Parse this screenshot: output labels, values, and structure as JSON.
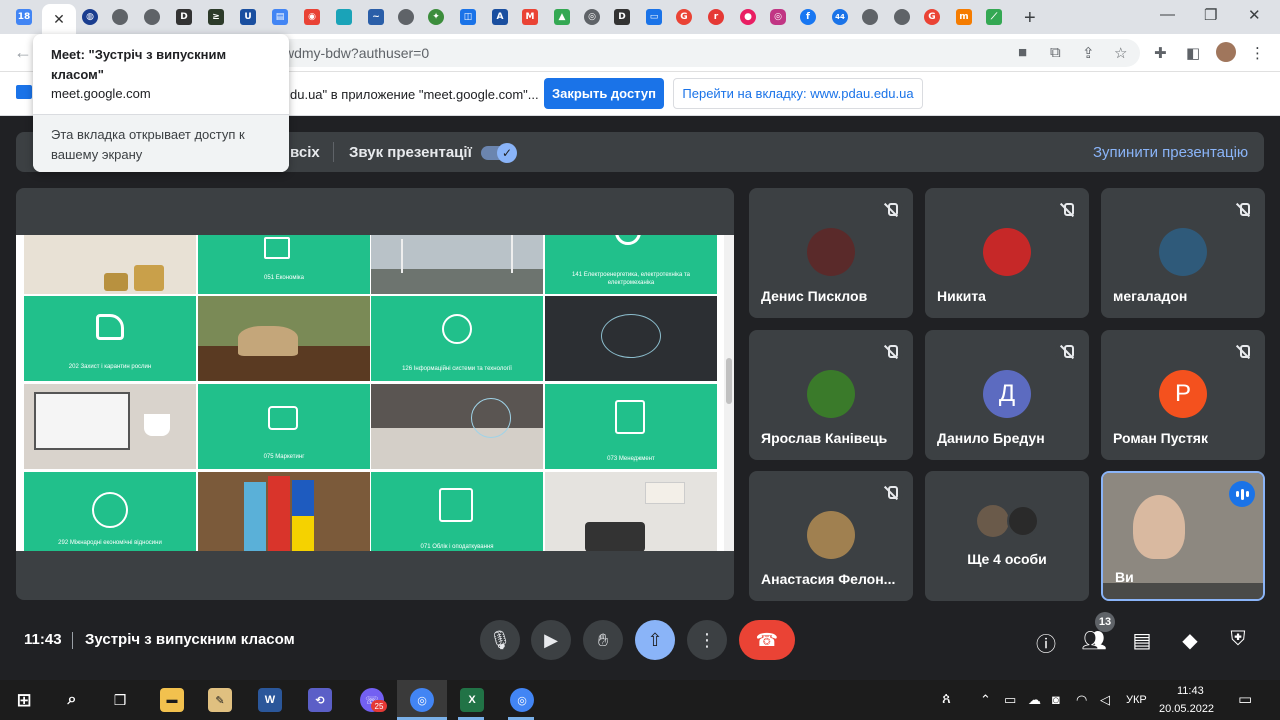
{
  "browser": {
    "tabs": [
      {
        "icon": "calendar-icon",
        "color": "#4285f4",
        "text": "18"
      },
      {
        "icon": "close-icon",
        "active": true
      },
      {
        "icon": "globe-icon",
        "color": "#1a3d8f"
      },
      {
        "icon": "web-icon",
        "color": "#5f6368"
      },
      {
        "icon": "web-icon",
        "color": "#5f6368"
      },
      {
        "icon": "d-icon",
        "color": "#333"
      },
      {
        "icon": "terminal-icon",
        "color": "#2d3b2a"
      },
      {
        "icon": "u-icon",
        "color": "#1a4fa0"
      },
      {
        "icon": "doc-icon",
        "color": "#4285f4"
      },
      {
        "icon": "photo-icon",
        "color": "#e94235"
      },
      {
        "icon": "square-icon",
        "color": "#1aa3b8"
      },
      {
        "icon": "bird-icon",
        "color": "#2a5ea8"
      },
      {
        "icon": "web-icon",
        "color": "#5f6368"
      },
      {
        "icon": "crest-icon",
        "color": "#3c8d3c"
      },
      {
        "icon": "book-icon",
        "color": "#1a73e8"
      },
      {
        "icon": "a-icon",
        "color": "#1a4fa0"
      },
      {
        "icon": "gmail-icon",
        "color": "#ea4335"
      },
      {
        "icon": "drive-icon",
        "color": "#34a853"
      },
      {
        "icon": "chrome-icon",
        "color": "#5f6368"
      },
      {
        "icon": "d-icon",
        "color": "#333"
      },
      {
        "icon": "monitor-icon",
        "color": "#1a73e8"
      },
      {
        "icon": "google-icon",
        "color": "#ea4335"
      },
      {
        "icon": "r-icon",
        "color": "#e53935"
      },
      {
        "icon": "circle-icon",
        "color": "#e91e63"
      },
      {
        "icon": "instagram-icon",
        "color": "#c13584"
      },
      {
        "icon": "facebook-icon",
        "color": "#1877f2"
      },
      {
        "icon": "number-icon",
        "color": "#1a73e8",
        "text": "44"
      },
      {
        "icon": "web-icon",
        "color": "#5f6368"
      },
      {
        "icon": "web-icon",
        "color": "#5f6368"
      },
      {
        "icon": "google-icon",
        "color": "#ea4335"
      },
      {
        "icon": "m-icon",
        "color": "#f57c00"
      },
      {
        "icon": "slides-icon",
        "color": "#34a853"
      }
    ],
    "url_tail": "wdmy-bdw?authuser=0",
    "tooltip": {
      "title": "Meet: \"Зустріч з випускним класом\"",
      "url": "meet.google.com",
      "note": "Эта вкладка открывает доступ к вашему экрану"
    },
    "infobar": {
      "text": "du.ua\" в приложение \"meet.google.com\"...",
      "stop_button": "Закрыть доступ",
      "goto_button": "Перейти на вкладку: www.pdau.edu.ua"
    }
  },
  "meet": {
    "presentation_bar": {
      "all_label": "всіх",
      "audio_label": "Звук презентації",
      "audio_toggle": "on",
      "stop_label": "Зупинити презентацію"
    },
    "slide": {
      "cells": [
        {
          "caption": "051 Економіка",
          "kind": "green"
        },
        {
          "caption": "141 Електроенергетика, електротехніка та електромеханіка",
          "kind": "green"
        },
        {
          "caption": "202 Захист і карантин рослин",
          "kind": "green"
        },
        {
          "caption": "126 Інформаційні системи та технології",
          "kind": "green"
        },
        {
          "caption": "075 Маркетинг",
          "kind": "green"
        },
        {
          "caption": "073 Менеджмент",
          "kind": "green"
        },
        {
          "caption": "292 Міжнародні економічні відносини",
          "kind": "green"
        },
        {
          "caption": "071 Облік і оподаткування",
          "kind": "green"
        }
      ]
    },
    "participants": [
      {
        "name": "Денис Писклов",
        "avatar_color": "#5a2a2a",
        "initial": ""
      },
      {
        "name": "Никита",
        "avatar_color": "#c62828",
        "initial": ""
      },
      {
        "name": "мегаладон",
        "avatar_color": "#2f5a7a",
        "initial": ""
      },
      {
        "name": "Ярослав Канівець",
        "avatar_color": "#3a7a2a",
        "initial": ""
      },
      {
        "name": "Данило Бредун",
        "avatar_color": "#5c6bc0",
        "initial": "Д"
      },
      {
        "name": "Роман Пустяк",
        "avatar_color": "#f4511e",
        "initial": "Р"
      },
      {
        "name": "Анастасия Фелон...",
        "avatar_color": "#a08050",
        "initial": ""
      },
      {
        "name": "Ще 4 особи",
        "avatar_color": "#555",
        "initial": ""
      },
      {
        "name": "Ви",
        "avatar_color": "#8a7a70",
        "initial": ""
      }
    ],
    "bottom": {
      "time": "11:43",
      "meeting_title": "Зустріч з випускним класом",
      "people_count": "13"
    }
  },
  "taskbar": {
    "language": "УКР",
    "time": "11:43",
    "date": "20.05.2022",
    "viber_badge": "25"
  }
}
